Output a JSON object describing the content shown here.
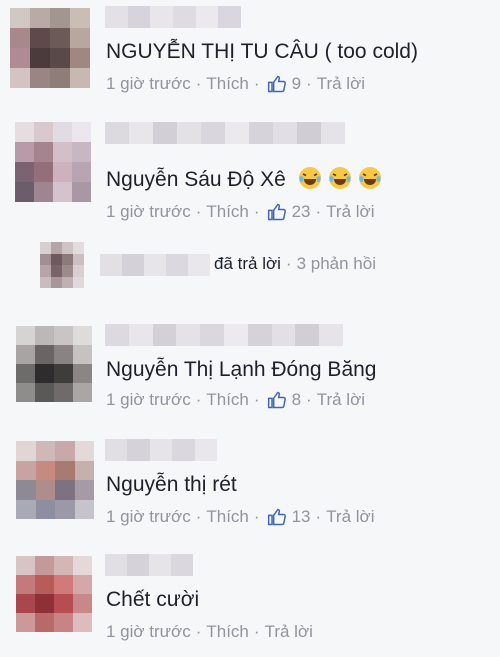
{
  "meta": {
    "time": "1 giờ trước",
    "like": "Thích",
    "reply": "Trả lời",
    "separator": "·"
  },
  "comments": [
    {
      "text": "NGUYỄN THỊ TU CÂU ( too cold)",
      "likes": "9"
    },
    {
      "text": "Nguyễn Sáu Độ Xê",
      "likes": "23"
    },
    {
      "text": "Nguyễn Thị Lạnh Đóng Băng",
      "likes": "8"
    },
    {
      "text": "Nguyễn thị rét",
      "likes": "13"
    },
    {
      "text": "Chết cười",
      "likes": ""
    }
  ],
  "reply_summary": {
    "action": "đã trả lời",
    "count_text": "3 phản hồi"
  },
  "colors": {
    "meta_text": "#90949c",
    "like_icon": "#4267b2",
    "divider": "#dddfe2"
  }
}
